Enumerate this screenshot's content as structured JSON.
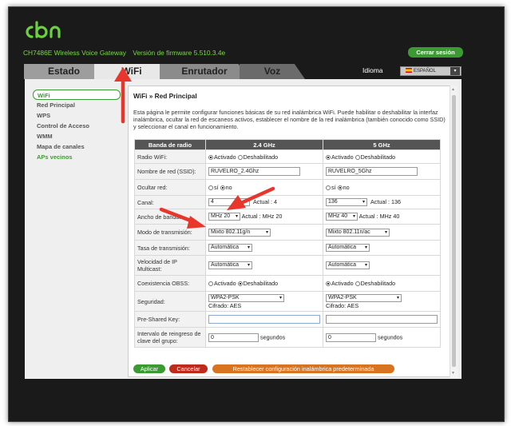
{
  "header": {
    "brand": "cbn",
    "device": "CH7486E Wireless Voice Gateway",
    "firmware_label": "Versión de firmware 5.510.3.4e",
    "logout_label": "Cerrar sesión",
    "language_label": "Idioma",
    "language_value": "ESPAÑOL"
  },
  "tabs": [
    {
      "label": "Estado"
    },
    {
      "label": "WiFi"
    },
    {
      "label": "Enrutador"
    },
    {
      "label": "Voz"
    }
  ],
  "sidebar": {
    "items": [
      {
        "label": "WiFi"
      },
      {
        "label": "Red Principal"
      },
      {
        "label": "WPS"
      },
      {
        "label": "Control de Acceso"
      },
      {
        "label": "WMM"
      },
      {
        "label": "Mapa de canales"
      },
      {
        "label": "APs vecinos"
      }
    ]
  },
  "page": {
    "title": "WiFi » Red Principal",
    "description": "Esta página le permite configurar funciones básicas de su red inalámbrica WiFi. Puede habilitar o deshabilitar la interfaz inalámbrica, ocultar la red de escaneos activos, establecer el nombre de la red inalámbrica (también conocido como SSID) y seleccionar el canal en funcionamiento."
  },
  "table": {
    "headers": [
      "Banda de radio",
      "2.4 GHz",
      "5 GHz"
    ],
    "rows": {
      "radio": {
        "label": "Radio WiFi:",
        "opt_on": "Activado",
        "opt_off": "Deshabilitado"
      },
      "ssid": {
        "label": "Nombre de red (SSID):",
        "v24": "RUVELRO_2.4Ghz",
        "v5": "RUVELRO_5Ghz"
      },
      "hidden": {
        "label": "Ocultar red:",
        "opt_yes": "sí",
        "opt_no": "no"
      },
      "channel": {
        "label": "Canal:",
        "v24": "4",
        "actual24": "Actual :  4",
        "v5": "136",
        "actual5": "Actual :  136",
        "actual_word": "Actual"
      },
      "bandwidth": {
        "label": "Ancho de banda:",
        "v24": "MHz 20",
        "actual24": "Actual :  MHz 20",
        "v5": "MHz 40",
        "actual5": "Actual :  MHz 40"
      },
      "mode": {
        "label": "Modo de transmisión:",
        "v24": "Mixto 802.11g/n",
        "v5": "Mixto 802.11n/ac"
      },
      "rate": {
        "label": "Tasa de transmisión:",
        "v24": "Automática",
        "v5": "Automática"
      },
      "multicast": {
        "label": "Velocidad de IP Multicast:",
        "v24": "Automática",
        "v5": "Automática"
      },
      "obss": {
        "label": "Coexistencia OBSS:",
        "opt_on": "Activado",
        "opt_off": "Deshabilitado"
      },
      "security": {
        "label": "Seguridad:",
        "v24": "WPA2-PSK",
        "cipher24": "Cifrado: AES",
        "v5": "WPA2-PSK",
        "cipher5": "Cifrado: AES"
      },
      "psk": {
        "label": "Pre-Shared Key:",
        "v24": "",
        "v5": ""
      },
      "rekey": {
        "label": "Intervalo de reingreso de clave del grupo:",
        "v24": "0",
        "v5": "0",
        "unit": "segundos"
      }
    }
  },
  "buttons": {
    "apply": "Aplicar",
    "cancel": "Cancelar",
    "restore": "Restablecer configuración inalámbrica predeterminada"
  },
  "colors": {
    "brand_green": "#3c9a32",
    "cancel_red": "#c02a1b",
    "restore_orange": "#d8731f",
    "annotation_red": "#e8362c"
  }
}
